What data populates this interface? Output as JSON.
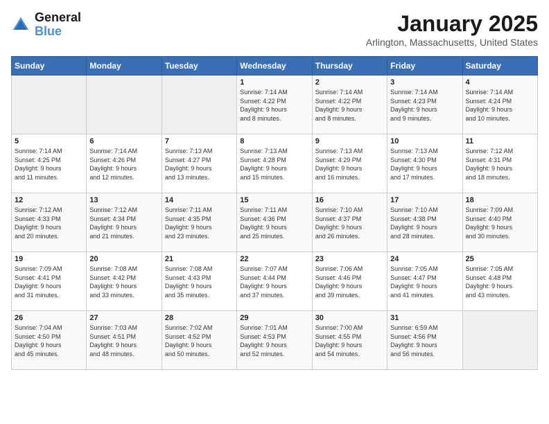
{
  "logo": {
    "text_general": "General",
    "text_blue": "Blue"
  },
  "title": "January 2025",
  "subtitle": "Arlington, Massachusetts, United States",
  "header_days": [
    "Sunday",
    "Monday",
    "Tuesday",
    "Wednesday",
    "Thursday",
    "Friday",
    "Saturday"
  ],
  "weeks": [
    [
      {
        "day": "",
        "content": ""
      },
      {
        "day": "",
        "content": ""
      },
      {
        "day": "",
        "content": ""
      },
      {
        "day": "1",
        "content": "Sunrise: 7:14 AM\nSunset: 4:22 PM\nDaylight: 9 hours\nand 8 minutes."
      },
      {
        "day": "2",
        "content": "Sunrise: 7:14 AM\nSunset: 4:22 PM\nDaylight: 9 hours\nand 8 minutes."
      },
      {
        "day": "3",
        "content": "Sunrise: 7:14 AM\nSunset: 4:23 PM\nDaylight: 9 hours\nand 9 minutes."
      },
      {
        "day": "4",
        "content": "Sunrise: 7:14 AM\nSunset: 4:24 PM\nDaylight: 9 hours\nand 10 minutes."
      }
    ],
    [
      {
        "day": "5",
        "content": "Sunrise: 7:14 AM\nSunset: 4:25 PM\nDaylight: 9 hours\nand 11 minutes."
      },
      {
        "day": "6",
        "content": "Sunrise: 7:14 AM\nSunset: 4:26 PM\nDaylight: 9 hours\nand 12 minutes."
      },
      {
        "day": "7",
        "content": "Sunrise: 7:13 AM\nSunset: 4:27 PM\nDaylight: 9 hours\nand 13 minutes."
      },
      {
        "day": "8",
        "content": "Sunrise: 7:13 AM\nSunset: 4:28 PM\nDaylight: 9 hours\nand 15 minutes."
      },
      {
        "day": "9",
        "content": "Sunrise: 7:13 AM\nSunset: 4:29 PM\nDaylight: 9 hours\nand 16 minutes."
      },
      {
        "day": "10",
        "content": "Sunrise: 7:13 AM\nSunset: 4:30 PM\nDaylight: 9 hours\nand 17 minutes."
      },
      {
        "day": "11",
        "content": "Sunrise: 7:12 AM\nSunset: 4:31 PM\nDaylight: 9 hours\nand 18 minutes."
      }
    ],
    [
      {
        "day": "12",
        "content": "Sunrise: 7:12 AM\nSunset: 4:33 PM\nDaylight: 9 hours\nand 20 minutes."
      },
      {
        "day": "13",
        "content": "Sunrise: 7:12 AM\nSunset: 4:34 PM\nDaylight: 9 hours\nand 21 minutes."
      },
      {
        "day": "14",
        "content": "Sunrise: 7:11 AM\nSunset: 4:35 PM\nDaylight: 9 hours\nand 23 minutes."
      },
      {
        "day": "15",
        "content": "Sunrise: 7:11 AM\nSunset: 4:36 PM\nDaylight: 9 hours\nand 25 minutes."
      },
      {
        "day": "16",
        "content": "Sunrise: 7:10 AM\nSunset: 4:37 PM\nDaylight: 9 hours\nand 26 minutes."
      },
      {
        "day": "17",
        "content": "Sunrise: 7:10 AM\nSunset: 4:38 PM\nDaylight: 9 hours\nand 28 minutes."
      },
      {
        "day": "18",
        "content": "Sunrise: 7:09 AM\nSunset: 4:40 PM\nDaylight: 9 hours\nand 30 minutes."
      }
    ],
    [
      {
        "day": "19",
        "content": "Sunrise: 7:09 AM\nSunset: 4:41 PM\nDaylight: 9 hours\nand 31 minutes."
      },
      {
        "day": "20",
        "content": "Sunrise: 7:08 AM\nSunset: 4:42 PM\nDaylight: 9 hours\nand 33 minutes."
      },
      {
        "day": "21",
        "content": "Sunrise: 7:08 AM\nSunset: 4:43 PM\nDaylight: 9 hours\nand 35 minutes."
      },
      {
        "day": "22",
        "content": "Sunrise: 7:07 AM\nSunset: 4:44 PM\nDaylight: 9 hours\nand 37 minutes."
      },
      {
        "day": "23",
        "content": "Sunrise: 7:06 AM\nSunset: 4:46 PM\nDaylight: 9 hours\nand 39 minutes."
      },
      {
        "day": "24",
        "content": "Sunrise: 7:05 AM\nSunset: 4:47 PM\nDaylight: 9 hours\nand 41 minutes."
      },
      {
        "day": "25",
        "content": "Sunrise: 7:05 AM\nSunset: 4:48 PM\nDaylight: 9 hours\nand 43 minutes."
      }
    ],
    [
      {
        "day": "26",
        "content": "Sunrise: 7:04 AM\nSunset: 4:50 PM\nDaylight: 9 hours\nand 45 minutes."
      },
      {
        "day": "27",
        "content": "Sunrise: 7:03 AM\nSunset: 4:51 PM\nDaylight: 9 hours\nand 48 minutes."
      },
      {
        "day": "28",
        "content": "Sunrise: 7:02 AM\nSunset: 4:52 PM\nDaylight: 9 hours\nand 50 minutes."
      },
      {
        "day": "29",
        "content": "Sunrise: 7:01 AM\nSunset: 4:53 PM\nDaylight: 9 hours\nand 52 minutes."
      },
      {
        "day": "30",
        "content": "Sunrise: 7:00 AM\nSunset: 4:55 PM\nDaylight: 9 hours\nand 54 minutes."
      },
      {
        "day": "31",
        "content": "Sunrise: 6:59 AM\nSunset: 4:56 PM\nDaylight: 9 hours\nand 56 minutes."
      },
      {
        "day": "",
        "content": ""
      }
    ]
  ]
}
